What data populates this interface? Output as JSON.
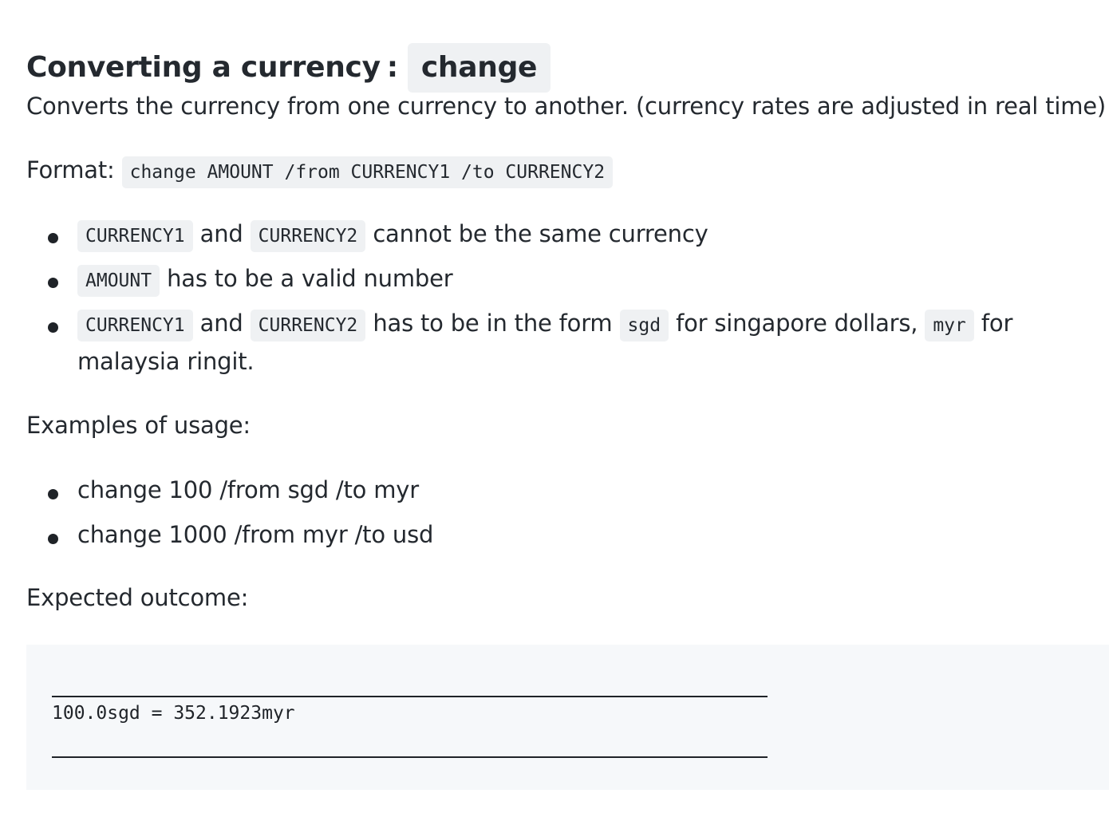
{
  "heading": {
    "title": "Converting a currency",
    "separator": ":",
    "command": "change"
  },
  "description": "Converts the currency from one currency to another. (currency rates are adjusted in real time)",
  "format": {
    "label": "Format:",
    "code": "change AMOUNT /from CURRENCY1 /to CURRENCY2"
  },
  "rules": {
    "r1": {
      "code_a": "CURRENCY1",
      "text_a": "and",
      "code_b": "CURRENCY2",
      "text_b": "cannot be the same currency"
    },
    "r2": {
      "code_a": "AMOUNT",
      "text_a": "has to be a valid number"
    },
    "r3": {
      "code_a": "CURRENCY1",
      "text_a": "and",
      "code_b": "CURRENCY2",
      "text_b": "has to be in the form",
      "code_c": "sgd",
      "text_c": "for singapore dollars,",
      "code_d": "myr",
      "text_d": "for",
      "text_e": "malaysia ringit."
    }
  },
  "examples": {
    "label": "Examples of usage:",
    "items": [
      "change 100 /from sgd /to myr",
      "change 1000 /from myr /to usd"
    ]
  },
  "outcome": {
    "label": "Expected outcome:",
    "result": "100.0sgd = 352.1923myr"
  },
  "colors": {
    "text": "#24292f",
    "code_bg": "#eff1f3",
    "block_bg": "#f6f8fa"
  }
}
